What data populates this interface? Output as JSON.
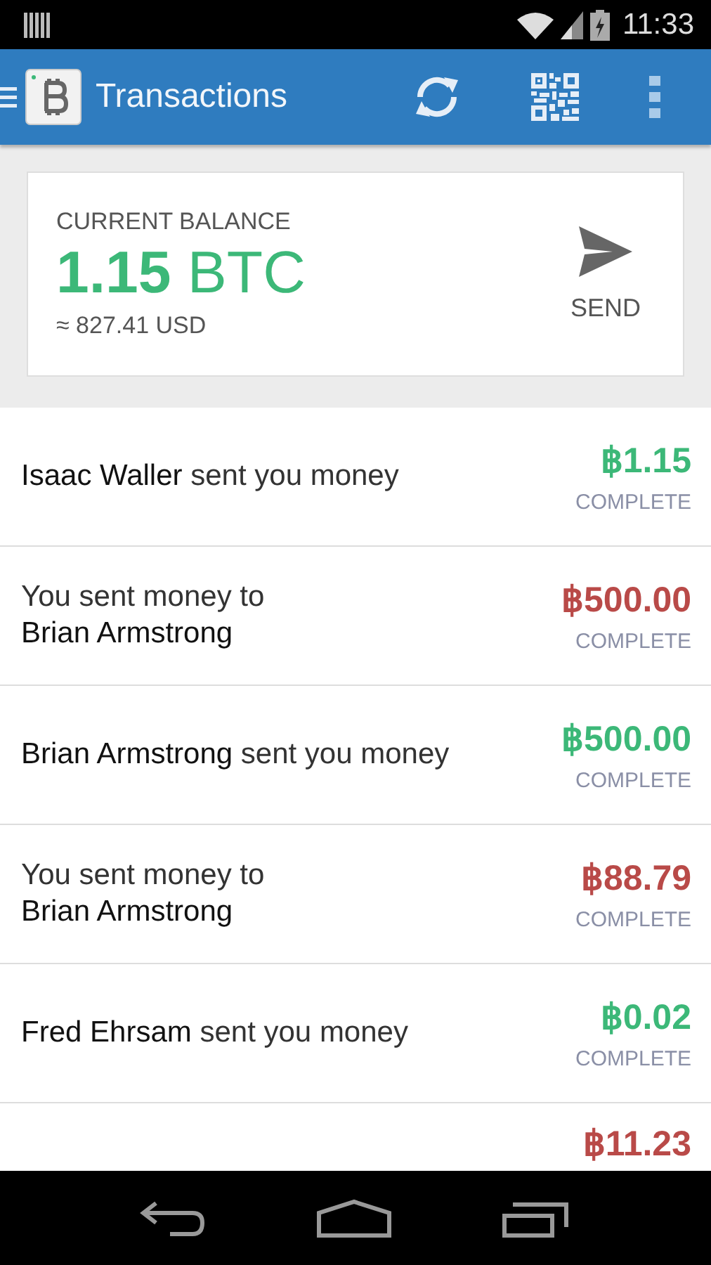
{
  "status_bar": {
    "time": "11:33"
  },
  "app_bar": {
    "title": "Transactions"
  },
  "balance": {
    "label": "CURRENT BALANCE",
    "amount": "1.15",
    "unit": "BTC",
    "fiat": "≈ 827.41 USD",
    "send_label": "SEND"
  },
  "transactions": [
    {
      "kind": "received",
      "name": "Isaac Waller",
      "text": "sent you money",
      "amount": "฿1.15",
      "status": "COMPLETE"
    },
    {
      "kind": "sent",
      "text": "You sent money to",
      "name": "Brian Armstrong",
      "amount": "฿500.00",
      "status": "COMPLETE"
    },
    {
      "kind": "received",
      "name": "Brian Armstrong",
      "text": "sent you money",
      "amount": "฿500.00",
      "status": "COMPLETE"
    },
    {
      "kind": "sent",
      "text": "You sent money to",
      "name": "Brian Armstrong",
      "amount": "฿88.79",
      "status": "COMPLETE"
    },
    {
      "kind": "received",
      "name": "Fred Ehrsam",
      "text": "sent you money",
      "amount": "฿0.02",
      "status": "COMPLETE"
    },
    {
      "kind": "sent",
      "amount": "฿11.23"
    }
  ]
}
